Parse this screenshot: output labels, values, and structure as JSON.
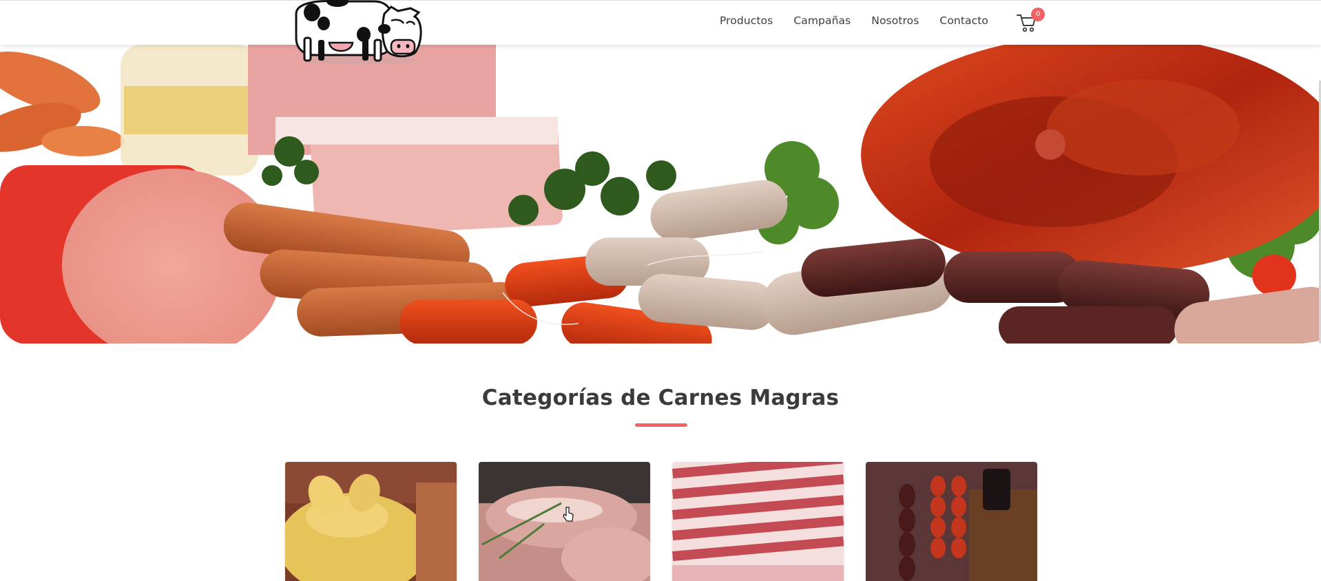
{
  "nav": {
    "items": [
      {
        "label": "Productos"
      },
      {
        "label": "Campañas"
      },
      {
        "label": "Nosotros"
      },
      {
        "label": "Contacto"
      }
    ],
    "cart_count": "0",
    "cart_icon": "shopping-cart-icon"
  },
  "brand": {
    "logo_icon": "cow-logo-icon"
  },
  "hero": {
    "image": "cured-meats-and-sausages-photo"
  },
  "section": {
    "title": "Categorías de Carnes Magras"
  },
  "categories": [
    {
      "image": "whole-chicken-photo"
    },
    {
      "image": "pork-loin-with-rosemary-photo"
    },
    {
      "image": "pork-ribs-photo"
    },
    {
      "image": "hanging-chorizo-and-morcilla-photo"
    }
  ],
  "colors": {
    "accent": "#f06465",
    "text": "#3b3b3b"
  }
}
